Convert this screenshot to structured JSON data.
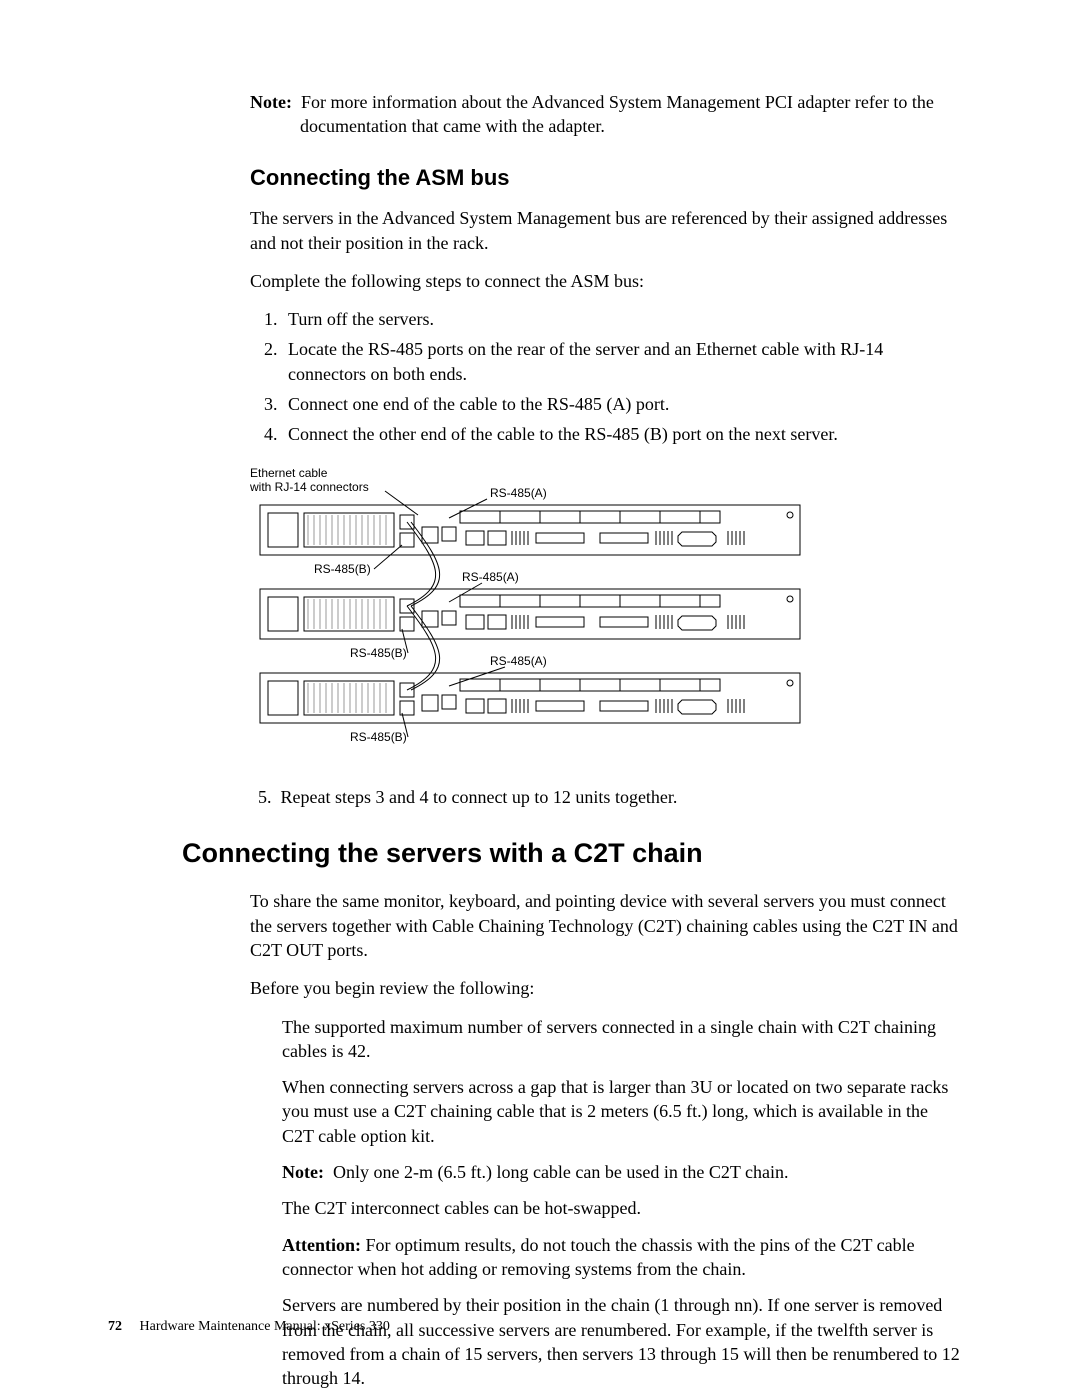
{
  "note_prefix": "Note:",
  "note_top": "For more information about the Advanced System Management PCI adapter refer to the documentation that came with the adapter.",
  "h2_asm": "Connecting the ASM bus",
  "asm_p1": "The servers in the Advanced System Management bus are referenced by their assigned addresses and not their position in the rack.",
  "asm_p2": "Complete the following steps to connect the ASM bus:",
  "steps": [
    "Turn off the servers.",
    "Locate the RS-485 ports on the rear of the server and an Ethernet cable with RJ-14 connectors on both ends.",
    "Connect one end of the cable to the RS-485 (A) port.",
    "Connect the other end of the cable to the RS-485 (B) port on the next server."
  ],
  "fig": {
    "eth_line1": "Ethernet cable",
    "eth_line2": "with RJ-14 connectors",
    "rs485a": "RS-485(A)",
    "rs485b": "RS-485(B)"
  },
  "step5_num": "5.",
  "step5": "Repeat steps 3 and 4 to connect up to 12 units together.",
  "h1_c2t": "Connecting the servers with a C2T chain",
  "c2t_p1": "To share the same monitor, keyboard, and pointing device with several servers you must connect the servers together with Cable Chaining Technology (C2T) chaining cables using  the C2T IN and C2T OUT ports.",
  "c2t_p2": "Before you begin review the following:",
  "c2t_b1": "The supported maximum number of servers connected in a single chain with C2T chaining cables is 42.",
  "c2t_b2": "When connecting servers across a gap that is larger than 3U or located on two separate racks you must use a C2T chaining cable that is 2 meters (6.5 ft.) long, which is available in the C2T cable option kit.",
  "c2t_note_prefix": "Note:",
  "c2t_note": "Only one 2-m (6.5 ft.) long cable can be used in the C2T chain.",
  "c2t_b3": "The C2T interconnect cables can be hot-swapped.",
  "c2t_attn_prefix": "Attention:",
  "c2t_attn": "For optimum results, do not touch the chassis with the pins of the C2T cable connector when hot adding or removing systems from the chain.",
  "c2t_b4": "Servers are numbered by their position in the chain (1 through nn).  If one server is removed from the chain, all successive servers are renumbered.  For example, if the twelfth server is removed from a chain of 15 servers, then servers 13 through 15 will then be renumbered to 12 through 14.",
  "footer_page": "72",
  "footer_text": "Hardware Maintenance Manual: xSeries 330"
}
